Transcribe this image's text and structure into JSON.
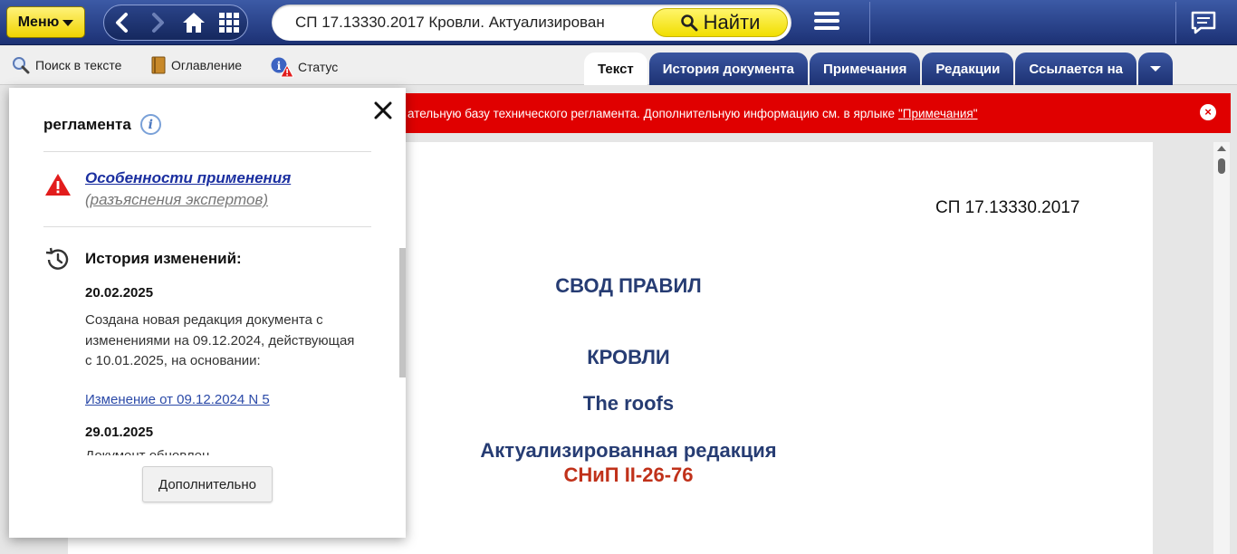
{
  "topbar": {
    "menu_label": "Меню",
    "search_value": "СП 17.13330.2017 Кровли. Актуализирован",
    "find_label": "Найти"
  },
  "toolbar": {
    "search_in_text": "Поиск в тексте",
    "contents": "Оглавление",
    "status": "Статус"
  },
  "tabs": [
    {
      "label": "Текст",
      "active": true
    },
    {
      "label": "История документа"
    },
    {
      "label": "Примечания"
    },
    {
      "label": "Редакции"
    },
    {
      "label": "Ссылается на"
    }
  ],
  "banner": {
    "text": "ательную базу технического регламента. Дополнительную информацию см. в ярлыке",
    "link": "\"Примечания\""
  },
  "document": {
    "number": "СП 17.13330.2017",
    "heading1": "СВОД ПРАВИЛ",
    "heading2": "КРОВЛИ",
    "heading3": "The roofs",
    "heading4": "Актуализированная редакция",
    "heading5": "СНиП II-26-76"
  },
  "popup": {
    "title": "регламента",
    "features_link": "Особенности применения",
    "features_sub": "(разъяснения экспертов)",
    "history_title": "История изменений:",
    "entries": [
      {
        "date": "20.02.2025",
        "text": "Создана новая редакция документа с изменениями на 09.12.2024, действующая с 10.01.2025, на основании:",
        "link": "Изменение от 09.12.2024 N 5"
      },
      {
        "date": "29.01.2025",
        "text": "Документ обновлен"
      }
    ],
    "more_button": "Дополнительно"
  },
  "colors": {
    "topbar": "#1c3174",
    "accent_yellow": "#f0d400",
    "banner_red": "#e00000",
    "doc_heading": "#263c73",
    "doc_heading_red": "#c0311a"
  }
}
